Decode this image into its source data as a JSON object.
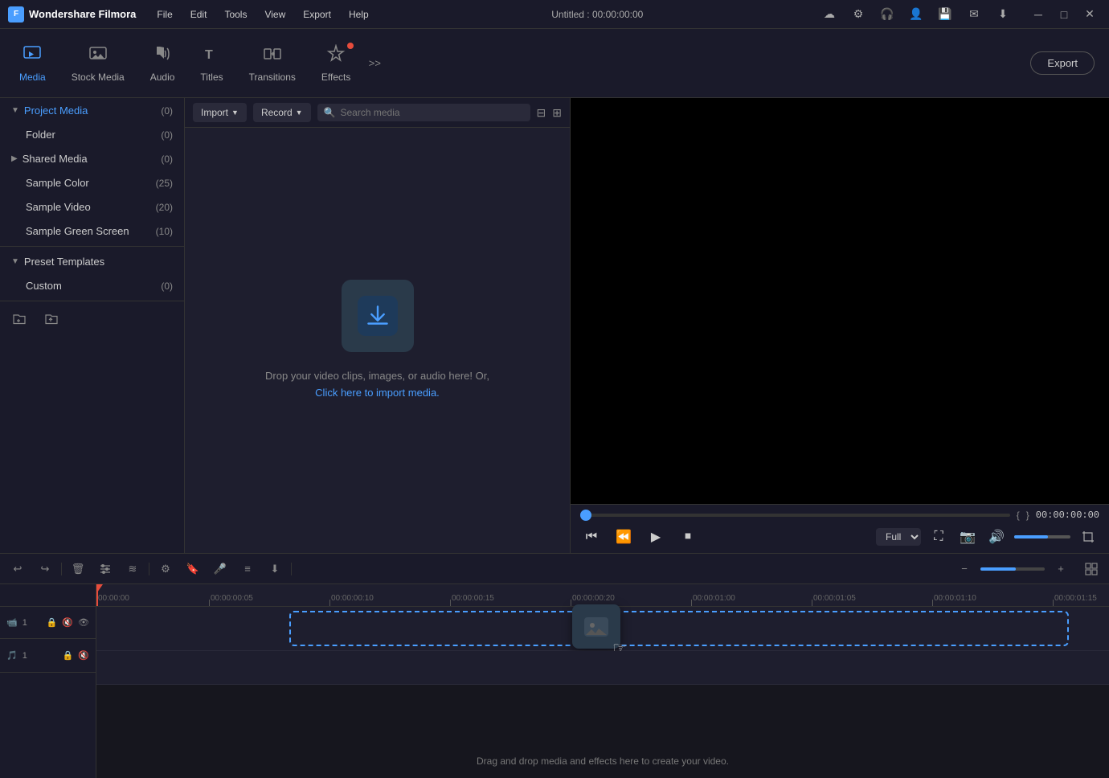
{
  "app": {
    "name": "Wondershare Filmora",
    "logo_letter": "F",
    "title": "Untitled : 00:00:00:00"
  },
  "menu": {
    "items": [
      "File",
      "Edit",
      "Tools",
      "View",
      "Export",
      "Help"
    ]
  },
  "toolbar": {
    "items": [
      {
        "id": "media",
        "label": "Media",
        "active": true
      },
      {
        "id": "stock-media",
        "label": "Stock Media",
        "active": false
      },
      {
        "id": "audio",
        "label": "Audio",
        "active": false
      },
      {
        "id": "titles",
        "label": "Titles",
        "active": false
      },
      {
        "id": "transitions",
        "label": "Transitions",
        "active": false
      },
      {
        "id": "effects",
        "label": "Effects",
        "active": false,
        "badge": true
      }
    ],
    "more_label": ">>",
    "export_label": "Export"
  },
  "sidebar": {
    "project_media": {
      "label": "Project Media",
      "count": "(0)",
      "expanded": true
    },
    "folder": {
      "label": "Folder",
      "count": "(0)"
    },
    "shared_media": {
      "label": "Shared Media",
      "count": "(0)",
      "expanded": false
    },
    "sample_color": {
      "label": "Sample Color",
      "count": "(25)"
    },
    "sample_video": {
      "label": "Sample Video",
      "count": "(20)"
    },
    "sample_green_screen": {
      "label": "Sample Green Screen",
      "count": "(10)"
    },
    "preset_templates": {
      "label": "Preset Templates",
      "expanded": true
    },
    "custom": {
      "label": "Custom",
      "count": "(0)"
    }
  },
  "media_panel": {
    "import_label": "Import",
    "record_label": "Record",
    "search_placeholder": "Search media",
    "drop_text": "Drop your video clips, images, or audio here! Or,",
    "drop_link": "Click here to import media."
  },
  "preview": {
    "timecode": "00:00:00:00",
    "quality": "Full",
    "bracket_open": "{",
    "bracket_close": "}"
  },
  "timeline": {
    "ruler_ticks": [
      {
        "label": "00:00:00",
        "position": 0
      },
      {
        "label": "00:00:00:05",
        "position": 140
      },
      {
        "label": "00:00:00:10",
        "position": 290
      },
      {
        "label": "00:00:00:15",
        "position": 440
      },
      {
        "label": "00:00:00:20",
        "position": 590
      },
      {
        "label": "00:00:01:00",
        "position": 740
      },
      {
        "label": "00:00:01:05",
        "position": 890
      },
      {
        "label": "00:00:01:10",
        "position": 1040
      },
      {
        "label": "00:00:01:15",
        "position": 1190
      }
    ],
    "drop_caption": "Drag and drop media and effects here to create your video.",
    "tracks": [
      {
        "id": 1,
        "icon": "📹",
        "lock": true,
        "mute": true,
        "eye": true
      },
      {
        "id": 2,
        "icon": "🎵",
        "lock": true,
        "mute": true,
        "eye": false
      }
    ]
  },
  "icons": {
    "search": "🔍",
    "filter": "⊟",
    "grid": "⊞",
    "chevron_down": "▼",
    "chevron_right": "▶",
    "new_folder": "📁",
    "import_folder": "📂",
    "undo": "↩",
    "redo": "↪",
    "delete": "🗑",
    "adjust": "⊞",
    "audio_wave": "≋",
    "settings": "⚙",
    "bookmark": "🔖",
    "mic": "🎤",
    "align": "≡",
    "insert": "⬇",
    "minus": "−",
    "plus": "+",
    "skip_back": "⏮",
    "step_back": "⏪",
    "play": "▶",
    "stop": "⏹",
    "skip_fwd": "⏭",
    "fullscreen": "⛶",
    "camera_snap": "📷",
    "volume": "🔊",
    "crop": "⛶",
    "zoom_out": "−",
    "zoom_in": "+",
    "lock": "🔒",
    "eye": "👁"
  }
}
